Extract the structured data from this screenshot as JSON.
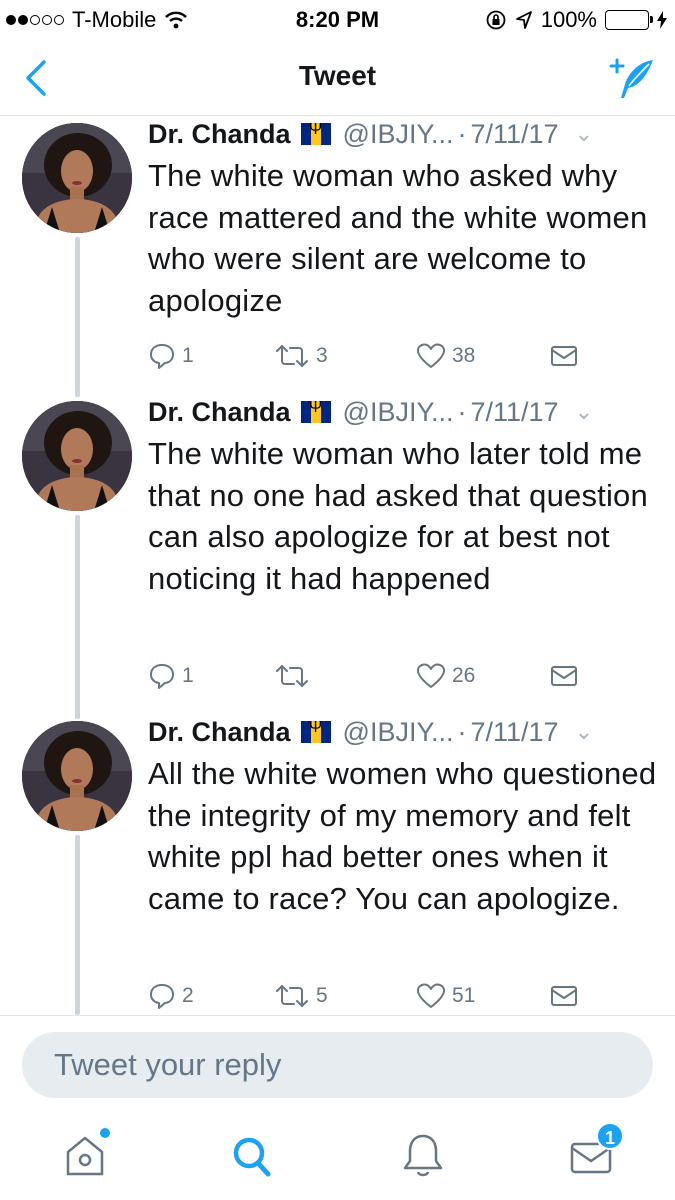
{
  "status_bar": {
    "carrier": "T-Mobile",
    "time": "8:20 PM",
    "battery": "100%",
    "signal_bars_filled": 2,
    "signal_bars_total": 5
  },
  "nav": {
    "title": "Tweet"
  },
  "tweets": [
    {
      "author": "Dr. Chanda",
      "handle": "@IBJIY...",
      "separator": "·",
      "date": "7/11/17",
      "text": "The white woman who asked why race mattered and the white women who were silent are welcome to apologize",
      "replies": "1",
      "retweets": "3",
      "likes": "38"
    },
    {
      "author": "Dr. Chanda",
      "handle": "@IBJIY...",
      "separator": "·",
      "date": "7/11/17",
      "text": "The white woman who later told me that no one had asked that question can also apologize for at best not noticing it had happened",
      "replies": "1",
      "retweets": "",
      "likes": "26"
    },
    {
      "author": "Dr. Chanda",
      "handle": "@IBJIY...",
      "separator": "·",
      "date": "7/11/17",
      "text": "All the white women who questioned the integrity of my memory and felt white ppl had better ones when it came to race? You can apologize.",
      "replies": "2",
      "retweets": "5",
      "likes": "51"
    }
  ],
  "reply": {
    "placeholder": "Tweet your reply"
  },
  "tab_bar": {
    "messages_badge": "1"
  },
  "colors": {
    "accent": "#1da1f2",
    "text": "#14171a",
    "secondary_text": "#657786",
    "thread_line": "#ccd6dd",
    "battery": "#4cd964"
  },
  "icons": [
    "back-chevron-icon",
    "compose-tweet-icon",
    "reply-icon",
    "retweet-icon",
    "like-icon",
    "direct-message-icon",
    "home-icon",
    "search-icon",
    "notifications-icon",
    "messages-icon"
  ]
}
